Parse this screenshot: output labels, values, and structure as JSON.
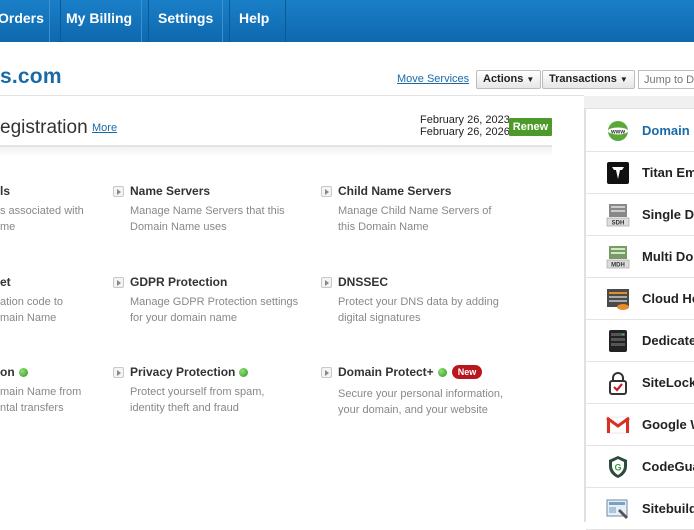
{
  "topnav": {
    "items": [
      {
        "label": "Orders"
      },
      {
        "label": "My Billing"
      },
      {
        "label": "Settings"
      },
      {
        "label": "Help"
      }
    ]
  },
  "header": {
    "domain": "s.com",
    "move_services": "Move Services",
    "actions_label": "Actions",
    "transactions_label": "Transactions",
    "jump_placeholder": "Jump to D"
  },
  "registration": {
    "title": "egistration",
    "more": "More",
    "date_registered": "February 26, 2023",
    "date_expiry": "February 26, 2026",
    "renew_label": "Renew"
  },
  "features": {
    "row1": [
      {
        "title": "ls",
        "desc1": "s associated with",
        "desc2": "me"
      },
      {
        "title": "Name Servers",
        "desc1": "Manage Name Servers that this",
        "desc2": "Domain Name uses"
      },
      {
        "title": "Child Name Servers",
        "desc1": "Manage Child Name Servers of",
        "desc2": "this Domain Name"
      }
    ],
    "row2": [
      {
        "title": "et",
        "desc1": "ation code to",
        "desc2": "main Name"
      },
      {
        "title": "GDPR Protection",
        "desc1": "Manage GDPR Protection settings",
        "desc2": "for your domain name"
      },
      {
        "title": "DNSSEC",
        "desc1": "Protect your DNS data by adding",
        "desc2": "digital signatures"
      }
    ],
    "row3": [
      {
        "title": "on",
        "desc1": "main Name from",
        "desc2": "ntal transfers"
      },
      {
        "title": "Privacy Protection",
        "desc1": "Protect yourself from spam,",
        "desc2": "identity theft and fraud"
      },
      {
        "title": "Domain Protect+",
        "badge": "New",
        "desc1": "Secure your personal information,",
        "desc2": "your domain, and your website"
      }
    ]
  },
  "sidebar": {
    "items": [
      {
        "label": "Domain N",
        "icon": "www-globe-icon"
      },
      {
        "label": "Titan Em",
        "icon": "titan-icon"
      },
      {
        "label": "Single Do",
        "icon": "sdh-server-icon"
      },
      {
        "label": "Multi Dor",
        "icon": "mdh-server-icon"
      },
      {
        "label": "Cloud Ho",
        "icon": "cloud-hosting-icon"
      },
      {
        "label": "Dedicate",
        "icon": "dedicated-server-icon"
      },
      {
        "label": "SiteLock",
        "icon": "sitelock-icon"
      },
      {
        "label": "Google W",
        "icon": "gmail-icon"
      },
      {
        "label": "CodeGua",
        "icon": "codeguard-shield-icon"
      },
      {
        "label": "Sitebuild",
        "icon": "sitebuilder-icon"
      }
    ]
  },
  "colors": {
    "nav_blue": "#1a7fc8",
    "link_blue": "#1a6aa8",
    "renew_green": "#4c9a2a",
    "badge_red": "#b8171e"
  }
}
